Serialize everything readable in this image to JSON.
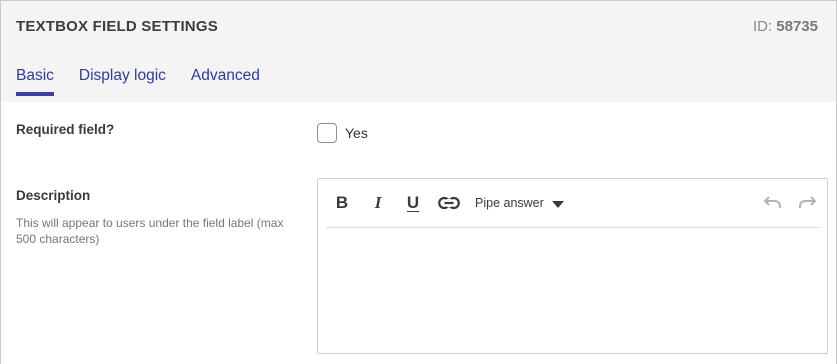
{
  "header": {
    "title": "TEXTBOX FIELD SETTINGS",
    "id_label": "ID:",
    "id_value": "58735"
  },
  "tabs": [
    {
      "label": "Basic",
      "active": true
    },
    {
      "label": "Display logic",
      "active": false
    },
    {
      "label": "Advanced",
      "active": false
    }
  ],
  "required": {
    "label": "Required field?",
    "checkbox_label": "Yes",
    "checked": false
  },
  "description": {
    "label": "Description",
    "help": "This will appear to users under the field label (max 500 characters)",
    "value": ""
  },
  "toolbar": {
    "bold": "B",
    "italic": "I",
    "underline": "U",
    "pipe_answer": "Pipe answer",
    "icons": [
      "bold-icon",
      "italic-icon",
      "underline-icon",
      "link-icon",
      "caret-down-icon",
      "undo-icon",
      "redo-icon"
    ]
  },
  "colors": {
    "accent": "#3a3fa6",
    "tab_text": "#2e3aa8",
    "header_bg": "#f4f4f4"
  }
}
